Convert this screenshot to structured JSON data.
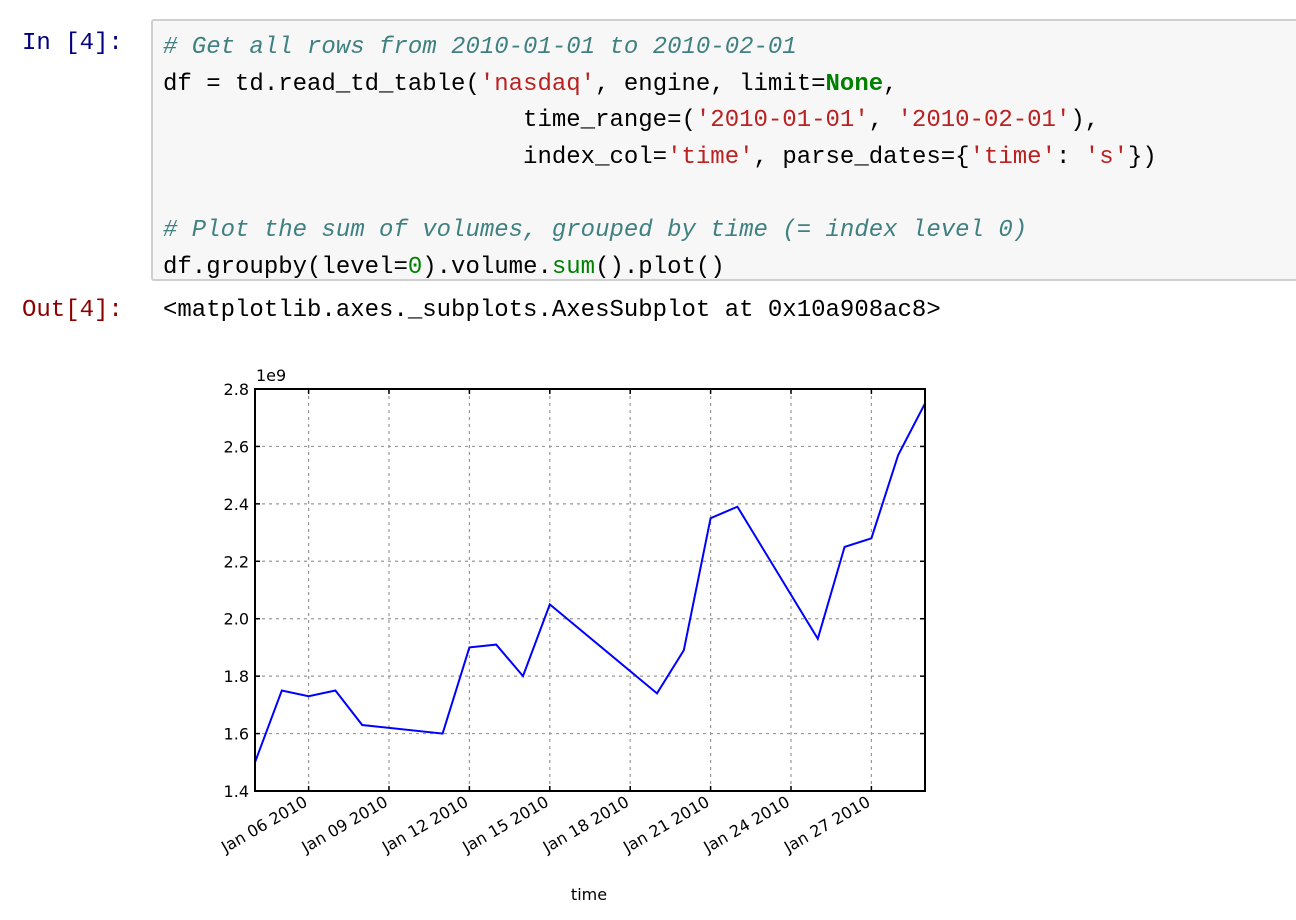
{
  "notebook": {
    "input_prompt": "In [4]:",
    "output_prompt": "Out[4]:",
    "code_lines": [
      [
        {
          "t": "cm",
          "v": "# Get all rows from 2010-01-01 to 2010-02-01"
        }
      ],
      [
        {
          "t": "",
          "v": "df = td.read_td_table("
        },
        {
          "t": "s",
          "v": "'nasdaq'"
        },
        {
          "t": "",
          "v": ", engine, limit="
        },
        {
          "t": "kw",
          "v": "None"
        },
        {
          "t": "",
          "v": ","
        }
      ],
      [
        {
          "t": "",
          "v": "                         time_range=("
        },
        {
          "t": "s",
          "v": "'2010-01-01'"
        },
        {
          "t": "",
          "v": ", "
        },
        {
          "t": "s",
          "v": "'2010-02-01'"
        },
        {
          "t": "",
          "v": "),"
        }
      ],
      [
        {
          "t": "",
          "v": "                         index_col="
        },
        {
          "t": "s",
          "v": "'time'"
        },
        {
          "t": "",
          "v": ", parse_dates={"
        },
        {
          "t": "s",
          "v": "'time'"
        },
        {
          "t": "",
          "v": ": "
        },
        {
          "t": "s",
          "v": "'s'"
        },
        {
          "t": "",
          "v": "})"
        }
      ],
      [
        {
          "t": "",
          "v": ""
        }
      ],
      [
        {
          "t": "cm",
          "v": "# Plot the sum of volumes, grouped by time (= index level 0)"
        }
      ],
      [
        {
          "t": "",
          "v": "df.groupby(level="
        },
        {
          "t": "mi",
          "v": "0"
        },
        {
          "t": "",
          "v": ").volume."
        },
        {
          "t": "nb",
          "v": "sum"
        },
        {
          "t": "",
          "v": "().plot()"
        }
      ]
    ],
    "output_text": "<matplotlib.axes._subplots.AxesSubplot at 0x10a908ac8>"
  },
  "colors": {
    "line": "#0000ff",
    "prompt_in": "#000080",
    "prompt_out": "#8b0000"
  },
  "chart_data": {
    "type": "line",
    "title": "",
    "xlabel": "time",
    "ylabel": "",
    "y_offset_label": "1e9",
    "ylim": [
      1.4,
      2.8
    ],
    "xlim": [
      "2010-01-04",
      "2010-01-29"
    ],
    "grid": true,
    "yticks": [
      "1.4",
      "1.6",
      "1.8",
      "2.0",
      "2.2",
      "2.4",
      "2.6",
      "2.8"
    ],
    "xticks": [
      {
        "date": "2010-01-06",
        "label": "Jan 06 2010"
      },
      {
        "date": "2010-01-09",
        "label": "Jan 09 2010"
      },
      {
        "date": "2010-01-12",
        "label": "Jan 12 2010"
      },
      {
        "date": "2010-01-15",
        "label": "Jan 15 2010"
      },
      {
        "date": "2010-01-18",
        "label": "Jan 18 2010"
      },
      {
        "date": "2010-01-21",
        "label": "Jan 21 2010"
      },
      {
        "date": "2010-01-24",
        "label": "Jan 24 2010"
      },
      {
        "date": "2010-01-27",
        "label": "Jan 27 2010"
      }
    ],
    "series": [
      {
        "name": "volume",
        "x": [
          "2010-01-04",
          "2010-01-05",
          "2010-01-06",
          "2010-01-07",
          "2010-01-08",
          "2010-01-11",
          "2010-01-12",
          "2010-01-13",
          "2010-01-14",
          "2010-01-15",
          "2010-01-19",
          "2010-01-20",
          "2010-01-21",
          "2010-01-22",
          "2010-01-25",
          "2010-01-26",
          "2010-01-27",
          "2010-01-28",
          "2010-01-29"
        ],
        "values": [
          1.5,
          1.75,
          1.73,
          1.75,
          1.63,
          1.6,
          1.9,
          1.91,
          1.8,
          2.05,
          1.74,
          1.89,
          2.35,
          2.39,
          1.93,
          2.25,
          2.28,
          2.57,
          2.75
        ]
      }
    ]
  }
}
